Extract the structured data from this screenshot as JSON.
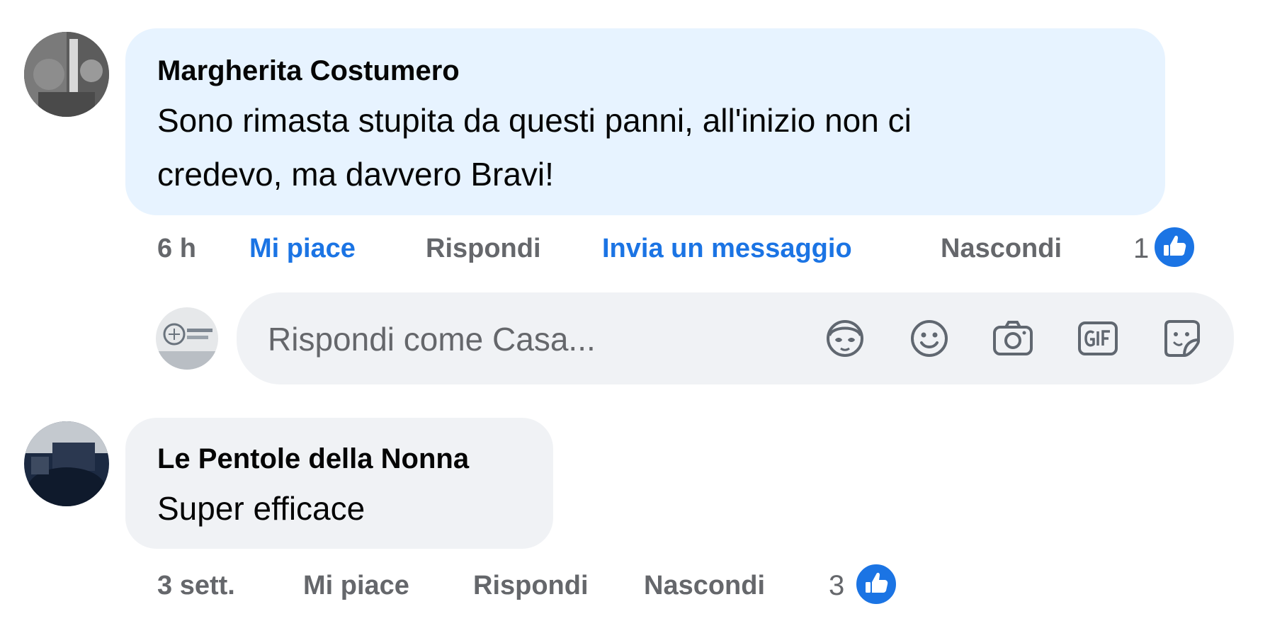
{
  "comments": [
    {
      "author": "Margherita Costumero",
      "text_line1": "Sono rimasta stupita da questi panni, all'inizio non ci",
      "text_line2": "credevo, ma davvero Bravi!",
      "time": "6 h",
      "like_label": "Mi piace",
      "reply_label": "Rispondi",
      "message_label": "Invia un messaggio",
      "hide_label": "Nascondi",
      "reaction_count": "1",
      "reaction_icon": "like-thumb-icon"
    },
    {
      "author": "Le Pentole della Nonna",
      "text": "Super efficace",
      "time": "3 sett.",
      "like_label": "Mi piace",
      "reply_label": "Rispondi",
      "hide_label": "Nascondi",
      "reaction_count": "3",
      "reaction_icon": "like-thumb-icon"
    }
  ],
  "reply_composer": {
    "placeholder": "Rispondi come Casa...",
    "tools": [
      "avatar-sticker-icon",
      "emoji-icon",
      "camera-icon",
      "gif-icon",
      "sticker-icon"
    ]
  },
  "colors": {
    "bubble_highlight": "#e7f3ff",
    "bubble_normal": "#f0f2f5",
    "accent": "#1b74e4",
    "secondary_text": "#65676b"
  }
}
